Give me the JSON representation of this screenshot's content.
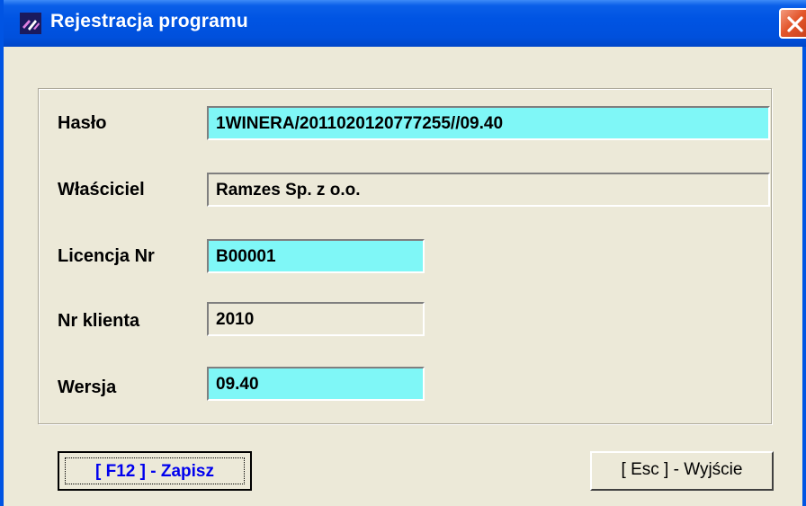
{
  "window": {
    "title": "Rejestracja programu"
  },
  "fields": {
    "haslo": {
      "label": "Hasło",
      "value": "1WINERA/2011020120777255//09.40"
    },
    "wlasciciel": {
      "label": "Właściciel",
      "value": "Ramzes Sp. z o.o."
    },
    "licencja": {
      "label": "Licencja Nr",
      "value": "B00001"
    },
    "nr_klienta": {
      "label": "Nr klienta",
      "value": "2010"
    },
    "wersja": {
      "label": "Wersja",
      "value": "09.40"
    }
  },
  "buttons": {
    "save_label": "[ F12 ] - Zapisz",
    "exit_label": "[ Esc ] - Wyjście"
  },
  "colors": {
    "titlebar": "#0054e3",
    "editable_field": "#7ff7f7",
    "dialog_bg": "#ece9d8",
    "save_text": "#0000ee"
  },
  "icons": {
    "app": "app-logo-icon",
    "close": "close-icon"
  }
}
